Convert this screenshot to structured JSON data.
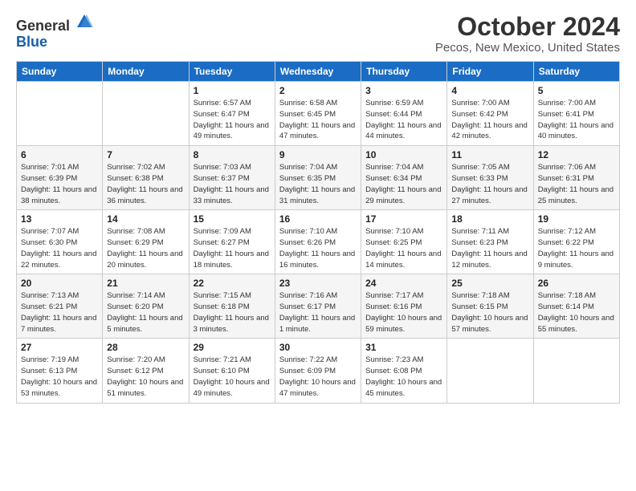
{
  "logo": {
    "general": "General",
    "blue": "Blue"
  },
  "title": "October 2024",
  "location": "Pecos, New Mexico, United States",
  "days_of_week": [
    "Sunday",
    "Monday",
    "Tuesday",
    "Wednesday",
    "Thursday",
    "Friday",
    "Saturday"
  ],
  "weeks": [
    [
      {
        "day": "",
        "info": ""
      },
      {
        "day": "",
        "info": ""
      },
      {
        "day": "1",
        "info": "Sunrise: 6:57 AM\nSunset: 6:47 PM\nDaylight: 11 hours and 49 minutes."
      },
      {
        "day": "2",
        "info": "Sunrise: 6:58 AM\nSunset: 6:45 PM\nDaylight: 11 hours and 47 minutes."
      },
      {
        "day": "3",
        "info": "Sunrise: 6:59 AM\nSunset: 6:44 PM\nDaylight: 11 hours and 44 minutes."
      },
      {
        "day": "4",
        "info": "Sunrise: 7:00 AM\nSunset: 6:42 PM\nDaylight: 11 hours and 42 minutes."
      },
      {
        "day": "5",
        "info": "Sunrise: 7:00 AM\nSunset: 6:41 PM\nDaylight: 11 hours and 40 minutes."
      }
    ],
    [
      {
        "day": "6",
        "info": "Sunrise: 7:01 AM\nSunset: 6:39 PM\nDaylight: 11 hours and 38 minutes."
      },
      {
        "day": "7",
        "info": "Sunrise: 7:02 AM\nSunset: 6:38 PM\nDaylight: 11 hours and 36 minutes."
      },
      {
        "day": "8",
        "info": "Sunrise: 7:03 AM\nSunset: 6:37 PM\nDaylight: 11 hours and 33 minutes."
      },
      {
        "day": "9",
        "info": "Sunrise: 7:04 AM\nSunset: 6:35 PM\nDaylight: 11 hours and 31 minutes."
      },
      {
        "day": "10",
        "info": "Sunrise: 7:04 AM\nSunset: 6:34 PM\nDaylight: 11 hours and 29 minutes."
      },
      {
        "day": "11",
        "info": "Sunrise: 7:05 AM\nSunset: 6:33 PM\nDaylight: 11 hours and 27 minutes."
      },
      {
        "day": "12",
        "info": "Sunrise: 7:06 AM\nSunset: 6:31 PM\nDaylight: 11 hours and 25 minutes."
      }
    ],
    [
      {
        "day": "13",
        "info": "Sunrise: 7:07 AM\nSunset: 6:30 PM\nDaylight: 11 hours and 22 minutes."
      },
      {
        "day": "14",
        "info": "Sunrise: 7:08 AM\nSunset: 6:29 PM\nDaylight: 11 hours and 20 minutes."
      },
      {
        "day": "15",
        "info": "Sunrise: 7:09 AM\nSunset: 6:27 PM\nDaylight: 11 hours and 18 minutes."
      },
      {
        "day": "16",
        "info": "Sunrise: 7:10 AM\nSunset: 6:26 PM\nDaylight: 11 hours and 16 minutes."
      },
      {
        "day": "17",
        "info": "Sunrise: 7:10 AM\nSunset: 6:25 PM\nDaylight: 11 hours and 14 minutes."
      },
      {
        "day": "18",
        "info": "Sunrise: 7:11 AM\nSunset: 6:23 PM\nDaylight: 11 hours and 12 minutes."
      },
      {
        "day": "19",
        "info": "Sunrise: 7:12 AM\nSunset: 6:22 PM\nDaylight: 11 hours and 9 minutes."
      }
    ],
    [
      {
        "day": "20",
        "info": "Sunrise: 7:13 AM\nSunset: 6:21 PM\nDaylight: 11 hours and 7 minutes."
      },
      {
        "day": "21",
        "info": "Sunrise: 7:14 AM\nSunset: 6:20 PM\nDaylight: 11 hours and 5 minutes."
      },
      {
        "day": "22",
        "info": "Sunrise: 7:15 AM\nSunset: 6:18 PM\nDaylight: 11 hours and 3 minutes."
      },
      {
        "day": "23",
        "info": "Sunrise: 7:16 AM\nSunset: 6:17 PM\nDaylight: 11 hours and 1 minute."
      },
      {
        "day": "24",
        "info": "Sunrise: 7:17 AM\nSunset: 6:16 PM\nDaylight: 10 hours and 59 minutes."
      },
      {
        "day": "25",
        "info": "Sunrise: 7:18 AM\nSunset: 6:15 PM\nDaylight: 10 hours and 57 minutes."
      },
      {
        "day": "26",
        "info": "Sunrise: 7:18 AM\nSunset: 6:14 PM\nDaylight: 10 hours and 55 minutes."
      }
    ],
    [
      {
        "day": "27",
        "info": "Sunrise: 7:19 AM\nSunset: 6:13 PM\nDaylight: 10 hours and 53 minutes."
      },
      {
        "day": "28",
        "info": "Sunrise: 7:20 AM\nSunset: 6:12 PM\nDaylight: 10 hours and 51 minutes."
      },
      {
        "day": "29",
        "info": "Sunrise: 7:21 AM\nSunset: 6:10 PM\nDaylight: 10 hours and 49 minutes."
      },
      {
        "day": "30",
        "info": "Sunrise: 7:22 AM\nSunset: 6:09 PM\nDaylight: 10 hours and 47 minutes."
      },
      {
        "day": "31",
        "info": "Sunrise: 7:23 AM\nSunset: 6:08 PM\nDaylight: 10 hours and 45 minutes."
      },
      {
        "day": "",
        "info": ""
      },
      {
        "day": "",
        "info": ""
      }
    ]
  ]
}
